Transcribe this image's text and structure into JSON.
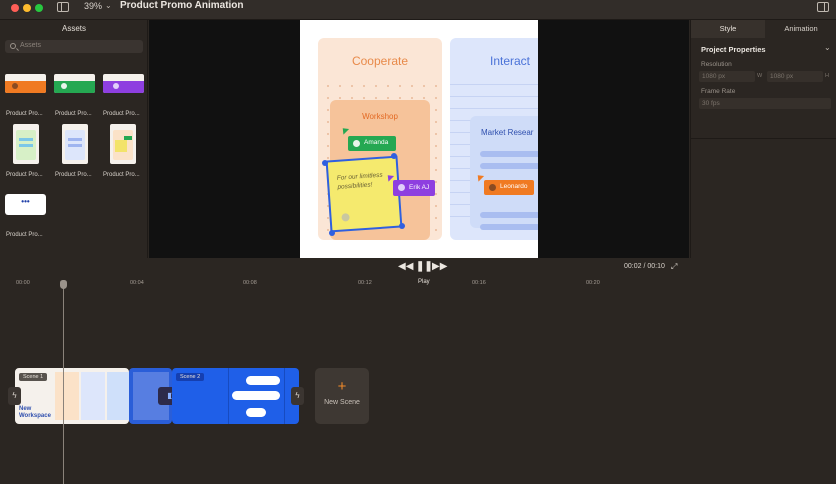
{
  "titlebar": {
    "zoom": "39%",
    "title": "Product Promo Animation"
  },
  "assets": {
    "title": "Assets",
    "search_placeholder": "Assets",
    "items": [
      {
        "label": "Product Pro..."
      },
      {
        "label": "Product Pro..."
      },
      {
        "label": "Product Pro..."
      },
      {
        "label": "Product Pro..."
      },
      {
        "label": "Product Pro..."
      },
      {
        "label": "Product Pro..."
      },
      {
        "label": "Product Pro..."
      }
    ],
    "more_label": "•••"
  },
  "artboard": {
    "card1_title": "Cooperate",
    "card2_title": "Interact",
    "workshop_label": "Workshop",
    "user1": "Amanda",
    "user2": "Erik AJ",
    "user3": "Leonardo",
    "sticky_text": "For our limitless possibilities!",
    "market_label": "Market Resear"
  },
  "properties": {
    "tab_style": "Style",
    "tab_animation": "Animation",
    "heading": "Project Properties",
    "resolution_label": "Resolution",
    "width_value": "1080 px",
    "width_unit": "W",
    "height_value": "1080 px",
    "height_unit": "H",
    "frame_rate_label": "Frame Rate",
    "frame_rate_value": "30 fps"
  },
  "transport": {
    "time": "00:02 / 00:10",
    "play_tooltip": "Play"
  },
  "ruler": {
    "labels": [
      "00:00",
      "00:04",
      "00:08",
      "00:12",
      "00:16",
      "00:20"
    ]
  },
  "timeline": {
    "scene1_badge": "Scene 1",
    "scene1_text": "New Workspace",
    "scene2_badge": "Scene 2",
    "new_scene_label": "New Scene"
  },
  "colors": {
    "accent_orange": "#f08a2a",
    "scene_blue": "#1f5fe8",
    "bg_dark": "#2b2622"
  }
}
